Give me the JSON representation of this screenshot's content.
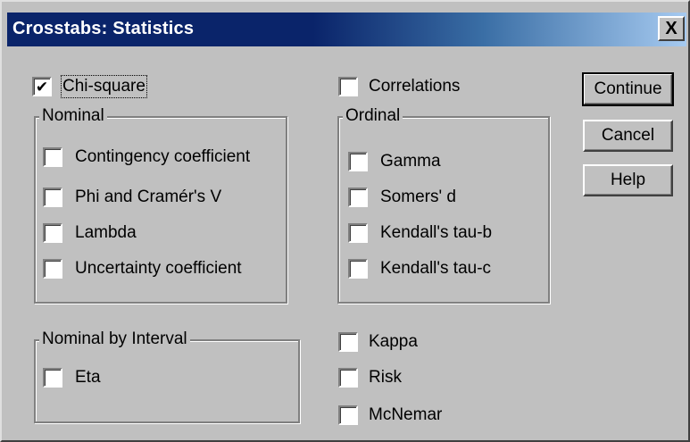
{
  "window": {
    "title": "Crosstabs: Statistics",
    "close_glyph": "X"
  },
  "top_options": [
    {
      "id": "chi-square",
      "label": "Chi-square",
      "checked": true
    },
    {
      "id": "correlations",
      "label": "Correlations",
      "checked": false
    }
  ],
  "groups": {
    "nominal": {
      "title": "Nominal",
      "items": [
        {
          "label": "Contingency coefficient",
          "checked": false
        },
        {
          "label": "Phi and Cramér's V",
          "checked": false
        },
        {
          "label": "Lambda",
          "checked": false
        },
        {
          "label": "Uncertainty coefficient",
          "checked": false
        }
      ]
    },
    "ordinal": {
      "title": "Ordinal",
      "items": [
        {
          "label": "Gamma",
          "checked": false
        },
        {
          "label": "Somers' d",
          "checked": false
        },
        {
          "label": "Kendall's tau-b",
          "checked": false
        },
        {
          "label": "Kendall's tau-c",
          "checked": false
        }
      ]
    },
    "nominal_by_interval": {
      "title": "Nominal by Interval",
      "items": [
        {
          "label": "Eta",
          "checked": false
        }
      ]
    }
  },
  "extra_options": [
    {
      "label": "Kappa",
      "checked": false
    },
    {
      "label": "Risk",
      "checked": false
    },
    {
      "label": "McNemar",
      "checked": false
    }
  ],
  "buttons": {
    "continue": "Continue",
    "cancel": "Cancel",
    "help": "Help"
  },
  "icons": {
    "check_mark": "check-icon",
    "close": "close-icon"
  }
}
